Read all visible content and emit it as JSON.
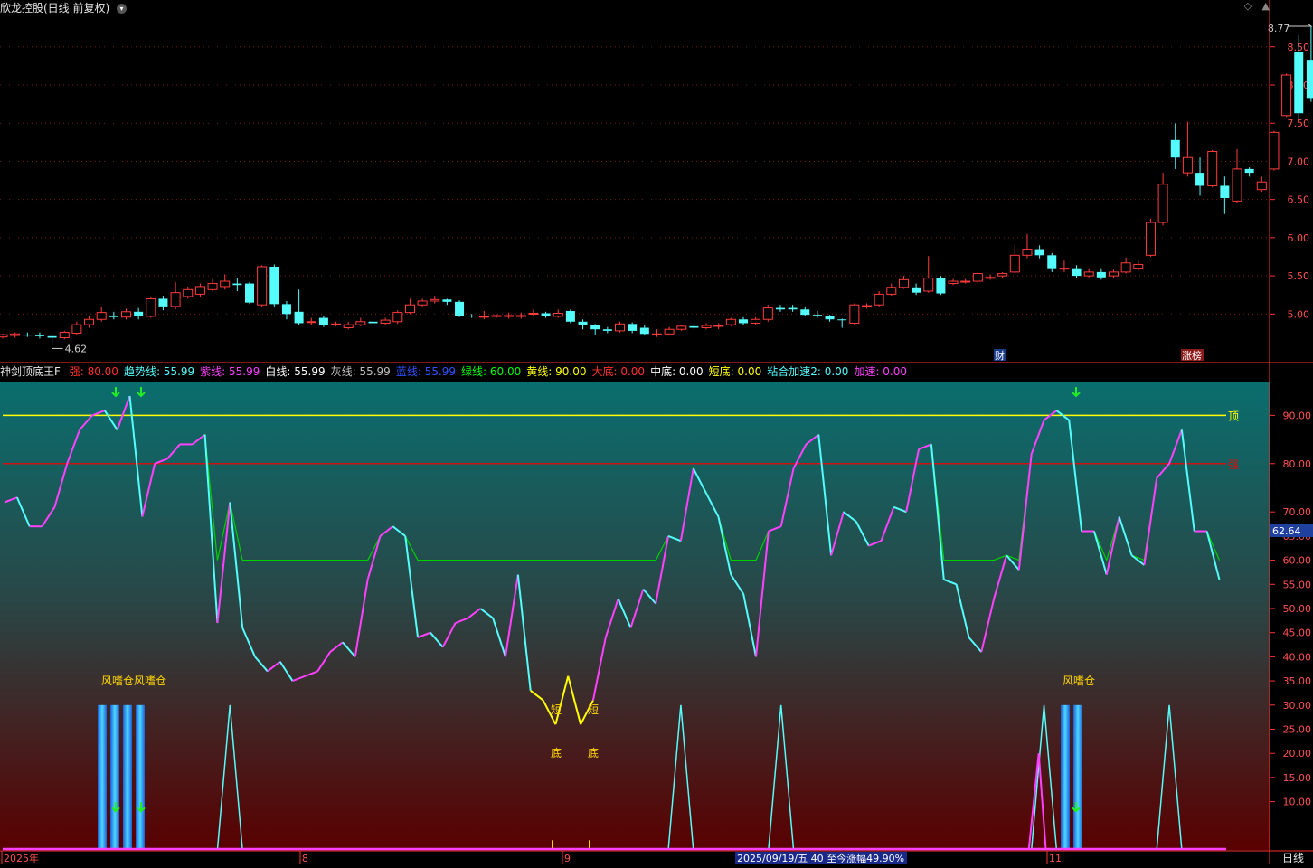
{
  "header": {
    "title": "欣龙控股(日线 前复权)",
    "icons": [
      "chevron-down-icon",
      "diamond-icon",
      "scroll-up-icon"
    ]
  },
  "colors": {
    "up": "#ff3c3c",
    "down": "#54fcfc",
    "magenta": "#ff40ff",
    "cyan": "#54fcfc",
    "green": "#00d000",
    "yellow": "#ffff00",
    "red": "#ff3030",
    "axis": "#ff3030"
  },
  "price_axis": {
    "ticks": [
      "8.50",
      "8.00",
      "7.50",
      "7.00",
      "6.50",
      "6.00",
      "5.50",
      "5.00"
    ]
  },
  "price_marks": {
    "high": "8.77",
    "low": "4.62",
    "badge_cai": "财",
    "badge_zb": "涨榜"
  },
  "indicator": {
    "title": "神剑顶底王F",
    "params": [
      {
        "label": "强:",
        "value": "80.00",
        "color": "#ff3030"
      },
      {
        "label": "趋势线:",
        "value": "55.99",
        "color": "#54fcfc"
      },
      {
        "label": "紫线:",
        "value": "55.99",
        "color": "#ff40ff"
      },
      {
        "label": "白线:",
        "value": "55.99",
        "color": "#ffffff"
      },
      {
        "label": "灰线:",
        "value": "55.99",
        "color": "#c0c0c0"
      },
      {
        "label": "蓝线:",
        "value": "55.99",
        "color": "#3050ff"
      },
      {
        "label": "绿线:",
        "value": "60.00",
        "color": "#00ff00"
      },
      {
        "label": "黄线:",
        "value": "90.00",
        "color": "#ffff00"
      },
      {
        "label": "大底:",
        "value": "0.00",
        "color": "#ff3030"
      },
      {
        "label": "中底:",
        "value": "0.00",
        "color": "#ffffff"
      },
      {
        "label": "短底:",
        "value": "0.00",
        "color": "#ffff00"
      },
      {
        "label": "粘合加速2:",
        "value": "0.00",
        "color": "#54fcfc"
      },
      {
        "label": "加速:",
        "value": "0.00",
        "color": "#ff40ff"
      }
    ],
    "top_label": "顶",
    "strong_label": "强",
    "current_value": "62.64",
    "ticks": [
      "90.00",
      "80.00",
      "70.00",
      "65.00",
      "60.00",
      "55.00",
      "50.00",
      "45.00",
      "40.00",
      "35.00",
      "30.00",
      "25.00",
      "20.00",
      "15.00",
      "10.00"
    ],
    "signal_text": "风嗜仓",
    "signal_text2": "风嗜仓风嗜仓",
    "short_label": "短",
    "bottom_label": "底"
  },
  "date_axis": {
    "labels": [
      "2025年",
      "8",
      "9",
      "11"
    ],
    "info": "2025/09/19/五 40 至今涨幅49.90%",
    "period": "日线"
  },
  "chart_data": [
    {
      "type": "candlestick",
      "title": "欣龙控股(日线 前复权)",
      "ylim": [
        4.4,
        8.9
      ],
      "y_ticks": [
        5.0,
        5.5,
        6.0,
        6.5,
        7.0,
        7.5,
        8.0,
        8.5
      ],
      "high": 8.77,
      "low": 4.62,
      "candles": [
        [
          4.7,
          4.73,
          4.68,
          4.74
        ],
        [
          4.72,
          4.74,
          4.69,
          4.76
        ],
        [
          4.73,
          4.72,
          4.7,
          4.76
        ],
        [
          4.73,
          4.71,
          4.68,
          4.76
        ],
        [
          4.71,
          4.69,
          4.62,
          4.73
        ],
        [
          4.69,
          4.76,
          4.67,
          4.78
        ],
        [
          4.75,
          4.86,
          4.72,
          4.9
        ],
        [
          4.86,
          4.93,
          4.82,
          4.98
        ],
        [
          4.93,
          5.02,
          4.9,
          5.1
        ],
        [
          4.98,
          4.96,
          4.93,
          5.03
        ],
        [
          4.96,
          5.03,
          4.93,
          5.07
        ],
        [
          5.03,
          4.97,
          4.93,
          5.08
        ],
        [
          4.97,
          5.2,
          4.95,
          5.22
        ],
        [
          5.2,
          5.1,
          5.05,
          5.24
        ],
        [
          5.1,
          5.28,
          5.06,
          5.42
        ],
        [
          5.23,
          5.32,
          5.2,
          5.36
        ],
        [
          5.26,
          5.36,
          5.22,
          5.4
        ],
        [
          5.32,
          5.4,
          5.3,
          5.46
        ],
        [
          5.36,
          5.43,
          5.32,
          5.52
        ],
        [
          5.4,
          5.38,
          5.3,
          5.47
        ],
        [
          5.4,
          5.15,
          5.13,
          5.42
        ],
        [
          5.12,
          5.62,
          5.1,
          5.64
        ],
        [
          5.62,
          5.13,
          5.1,
          5.65
        ],
        [
          5.13,
          5.0,
          4.93,
          5.17
        ],
        [
          5.03,
          4.88,
          4.86,
          5.32
        ],
        [
          4.9,
          4.9,
          4.86,
          4.95
        ],
        [
          4.95,
          4.85,
          4.83,
          4.98
        ],
        [
          4.87,
          4.87,
          4.84,
          4.9
        ],
        [
          4.82,
          4.86,
          4.8,
          4.9
        ],
        [
          4.86,
          4.9,
          4.84,
          4.95
        ],
        [
          4.9,
          4.88,
          4.86,
          4.94
        ],
        [
          4.88,
          4.92,
          4.86,
          4.95
        ],
        [
          4.9,
          5.02,
          4.87,
          5.05
        ],
        [
          5.02,
          5.12,
          5.0,
          5.2
        ],
        [
          5.12,
          5.17,
          5.1,
          5.2
        ],
        [
          5.17,
          5.19,
          5.14,
          5.24
        ],
        [
          5.19,
          5.16,
          5.12,
          5.2
        ],
        [
          5.16,
          4.98,
          4.96,
          5.18
        ],
        [
          4.98,
          4.97,
          4.95,
          5.0
        ],
        [
          4.97,
          4.97,
          4.93,
          5.04
        ],
        [
          4.97,
          4.98,
          4.95,
          5.0
        ],
        [
          4.98,
          4.98,
          4.94,
          5.02
        ],
        [
          4.98,
          4.98,
          4.94,
          5.02
        ],
        [
          5.0,
          5.01,
          4.98,
          5.06
        ],
        [
          5.01,
          4.97,
          4.95,
          5.03
        ],
        [
          4.97,
          5.01,
          4.95,
          5.06
        ],
        [
          5.04,
          4.9,
          4.88,
          5.06
        ],
        [
          4.9,
          4.85,
          4.8,
          4.93
        ],
        [
          4.85,
          4.8,
          4.73,
          4.87
        ],
        [
          4.8,
          4.78,
          4.75,
          4.83
        ],
        [
          4.78,
          4.87,
          4.76,
          4.9
        ],
        [
          4.87,
          4.78,
          4.75,
          4.89
        ],
        [
          4.82,
          4.74,
          4.72,
          4.86
        ],
        [
          4.74,
          4.74,
          4.7,
          4.8
        ],
        [
          4.74,
          4.8,
          4.72,
          4.83
        ],
        [
          4.8,
          4.84,
          4.78,
          4.86
        ],
        [
          4.84,
          4.82,
          4.8,
          4.88
        ],
        [
          4.82,
          4.85,
          4.8,
          4.88
        ],
        [
          4.85,
          4.85,
          4.8,
          4.88
        ],
        [
          4.86,
          4.93,
          4.84,
          4.95
        ],
        [
          4.93,
          4.88,
          4.86,
          4.96
        ],
        [
          4.88,
          4.93,
          4.86,
          4.96
        ],
        [
          4.93,
          5.08,
          4.9,
          5.12
        ],
        [
          5.08,
          5.06,
          5.03,
          5.12
        ],
        [
          5.08,
          5.06,
          5.03,
          5.12
        ],
        [
          5.06,
          4.99,
          4.97,
          5.1
        ],
        [
          4.99,
          4.98,
          4.95,
          5.04
        ],
        [
          4.98,
          4.93,
          4.9,
          4.99
        ],
        [
          4.93,
          4.92,
          4.82,
          4.94
        ],
        [
          4.88,
          5.12,
          4.86,
          5.14
        ],
        [
          5.1,
          5.11,
          5.07,
          5.14
        ],
        [
          5.12,
          5.26,
          5.1,
          5.3
        ],
        [
          5.26,
          5.35,
          5.24,
          5.4
        ],
        [
          5.35,
          5.45,
          5.33,
          5.5
        ],
        [
          5.35,
          5.28,
          5.25,
          5.4
        ],
        [
          5.3,
          5.47,
          5.28,
          5.76
        ],
        [
          5.47,
          5.27,
          5.25,
          5.5
        ],
        [
          5.4,
          5.43,
          5.38,
          5.46
        ],
        [
          5.43,
          5.43,
          5.4,
          5.46
        ],
        [
          5.43,
          5.53,
          5.4,
          5.55
        ],
        [
          5.48,
          5.48,
          5.45,
          5.52
        ],
        [
          5.5,
          5.53,
          5.47,
          5.55
        ],
        [
          5.55,
          5.77,
          5.53,
          5.9
        ],
        [
          5.77,
          5.85,
          5.73,
          6.05
        ],
        [
          5.85,
          5.77,
          5.73,
          5.9
        ],
        [
          5.77,
          5.6,
          5.55,
          5.8
        ],
        [
          5.6,
          5.6,
          5.55,
          5.7
        ],
        [
          5.6,
          5.5,
          5.47,
          5.64
        ],
        [
          5.5,
          5.55,
          5.48,
          5.6
        ],
        [
          5.55,
          5.48,
          5.45,
          5.6
        ],
        [
          5.5,
          5.55,
          5.47,
          5.58
        ],
        [
          5.55,
          5.67,
          5.53,
          5.74
        ],
        [
          5.6,
          5.65,
          5.57,
          5.7
        ],
        [
          5.77,
          6.2,
          5.75,
          6.25
        ],
        [
          6.2,
          6.7,
          6.16,
          6.85
        ],
        [
          7.28,
          7.05,
          6.9,
          7.5
        ],
        [
          6.85,
          7.05,
          6.8,
          7.52
        ],
        [
          6.85,
          6.68,
          6.55,
          7.05
        ],
        [
          6.68,
          7.13,
          6.66,
          7.15
        ],
        [
          6.68,
          6.52,
          6.31,
          6.8
        ],
        [
          6.48,
          6.9,
          6.46,
          7.16
        ],
        [
          6.9,
          6.85,
          6.8,
          6.92
        ],
        [
          6.63,
          6.73,
          6.6,
          6.8
        ],
        [
          6.9,
          7.38,
          6.88,
          7.4
        ],
        [
          7.6,
          8.13,
          7.58,
          8.15
        ],
        [
          8.43,
          7.63,
          7.55,
          8.65
        ],
        [
          8.33,
          7.83,
          7.78,
          8.77
        ],
        [
          7.83,
          7.38,
          7.15,
          7.98
        ],
        [
          7.58,
          7.6,
          7.3,
          8.0
        ]
      ]
    },
    {
      "type": "line",
      "title": "神剑顶底王F",
      "ylim": [
        0,
        97
      ],
      "reference_lines": [
        {
          "name": "顶",
          "value": 90
        },
        {
          "name": "强",
          "value": 80
        }
      ],
      "series": [
        {
          "name": "趋势线",
          "values": [
            72,
            73,
            67,
            67,
            71,
            80,
            87,
            90,
            91,
            87,
            94,
            69,
            80,
            81,
            84,
            84,
            86,
            47,
            72,
            46,
            40,
            37,
            39,
            35,
            36,
            37,
            41,
            43,
            40,
            56,
            65,
            67,
            65,
            44,
            45,
            42,
            47,
            48,
            50,
            48,
            40,
            57,
            33,
            31,
            26,
            36,
            26,
            31,
            44,
            52,
            46,
            54,
            51,
            65,
            64,
            79,
            74,
            69,
            57,
            53,
            40,
            66,
            67,
            79,
            84,
            86,
            61,
            70,
            68,
            63,
            64,
            71,
            70,
            83,
            84,
            56,
            55,
            44,
            41,
            52,
            61,
            58,
            82,
            89,
            91,
            89,
            66,
            66,
            57,
            69,
            61,
            59,
            77,
            80,
            87,
            66,
            66,
            56
          ]
        }
      ]
    }
  ]
}
